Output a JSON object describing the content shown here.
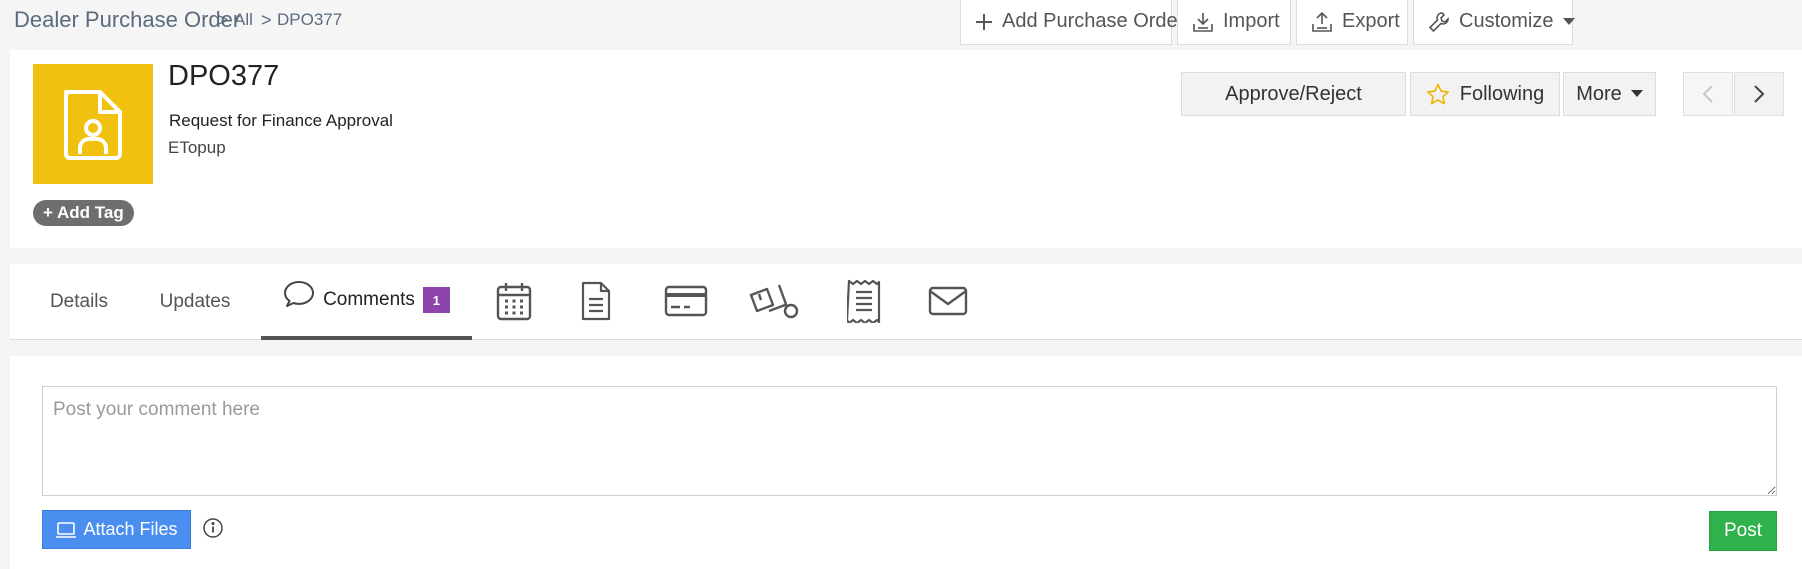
{
  "breadcrumb": {
    "module": "Dealer Purchase Order",
    "separator": ">",
    "view": "All",
    "record": "DPO377"
  },
  "toolbar": {
    "add_label": "Add Purchase Order",
    "import_label": "Import",
    "export_label": "Export",
    "customize_label": "Customize"
  },
  "record": {
    "title": "DPO377",
    "subtitle": "Request for Finance Approval",
    "subtitle2": "ETopup",
    "icon": "document-user-icon",
    "icon_bg": "#f0c20f",
    "add_tag_label": "+ Add Tag"
  },
  "actions": {
    "approve_label": "Approve/Reject",
    "following_label": "Following",
    "more_label": "More"
  },
  "tabs": {
    "details": "Details",
    "updates": "Updates",
    "comments": "Comments",
    "comments_count": "1",
    "icon_tabs": [
      "calendar-icon",
      "document-icon",
      "credit-card-icon",
      "delivery-icon",
      "receipt-icon",
      "mail-icon"
    ]
  },
  "comment": {
    "placeholder": "Post your comment here",
    "value": "",
    "attach_label": "Attach Files",
    "post_label": "Post"
  },
  "colors": {
    "badge": "#8e44ad",
    "attach_button": "#4a8ef0",
    "post_button": "#2fb24c",
    "star": "#f0b400"
  }
}
